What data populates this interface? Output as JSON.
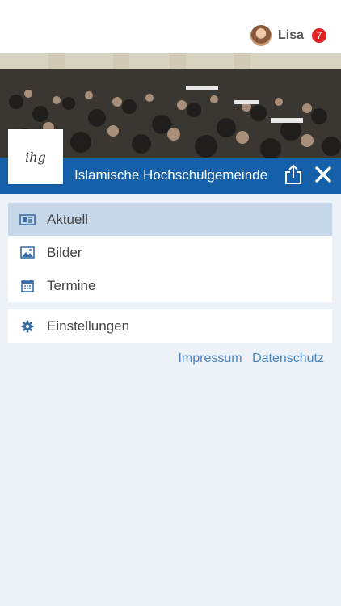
{
  "user": {
    "name": "Lisa",
    "notifications": "7"
  },
  "header": {
    "title": "Islamische Hochschulgemeinde",
    "logo_text": "ihg"
  },
  "menu": {
    "items": [
      {
        "label": "Aktuell",
        "icon": "newspaper-icon",
        "active": true
      },
      {
        "label": "Bilder",
        "icon": "image-icon",
        "active": false
      },
      {
        "label": "Termine",
        "icon": "calendar-icon",
        "active": false
      }
    ],
    "settings": {
      "label": "Einstellungen",
      "icon": "gear-icon"
    }
  },
  "footer_links": {
    "impressum": "Impressum",
    "datenschutz": "Datenschutz"
  },
  "colors": {
    "accent": "#1560a8",
    "active_bg": "#c6d7ea",
    "link": "#4b84bb",
    "badge": "#e02424"
  }
}
